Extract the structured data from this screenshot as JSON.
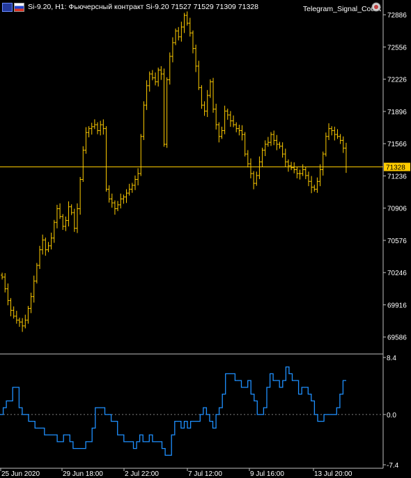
{
  "header": {
    "chart_title": "Si-9.20, H1:  Фьючерсный контракт Si-9.20  71527 71529 71309 71328",
    "ea_name": "Telegram_Signal_Count"
  },
  "colors": {
    "background": "#000000",
    "bars": "#ffcc00",
    "price_line": "#ffcc00",
    "indicator": "#1e90ff",
    "axis": "#c0c0c0",
    "zero_line": "#808080"
  },
  "chart_data": [
    {
      "type": "ohlc",
      "title": "Si-9.20, H1",
      "ylim": [
        69420,
        72980
      ],
      "y_ticks": [
        "72886",
        "72556",
        "72226",
        "71896",
        "71566",
        "71236",
        "70906",
        "70576",
        "70246",
        "69916",
        "69586"
      ],
      "current_price": "71328",
      "close_series": [
        70200,
        70080,
        69960,
        69860,
        69800,
        69760,
        69740,
        69700,
        69760,
        69880,
        70000,
        70160,
        70320,
        70480,
        70580,
        70480,
        70520,
        70600,
        70760,
        70900,
        70820,
        70720,
        70780,
        70920,
        70860,
        70700,
        70900,
        71200,
        71500,
        71680,
        71720,
        71740,
        71760,
        71700,
        71760,
        71720,
        71100,
        71000,
        70960,
        70900,
        70940,
        71000,
        71020,
        71060,
        71100,
        71140,
        71200,
        71260,
        71640,
        71960,
        72160,
        72280,
        72240,
        72200,
        72320,
        72280,
        71560,
        72220,
        72460,
        72600,
        72720,
        72660,
        72760,
        72880,
        72800,
        72700,
        72540,
        72360,
        72140,
        71960,
        71900,
        72060,
        72200,
        71920,
        71760,
        71640,
        71700,
        71900,
        71860,
        71800,
        71760,
        71720,
        71700,
        71660,
        71460,
        71360,
        71260,
        71160,
        71240,
        71380,
        71500,
        71560,
        71580,
        71660,
        71600,
        71560,
        71540,
        71460,
        71380,
        71340,
        71320,
        71300,
        71260,
        71260,
        71300,
        71240,
        71180,
        71120,
        71100,
        71180,
        71300,
        71460,
        71640,
        71720,
        71700,
        71660,
        71640,
        71600,
        71520,
        71328
      ],
      "x_labels": [
        "25 Jun 2020",
        "29 Jun 18:00",
        "2 Jul 22:00",
        "7 Jul 12:00",
        "9 Jul 16:00",
        "13 Jul 20:00"
      ]
    },
    {
      "type": "line",
      "name": "indicator",
      "ylim": [
        -7.4,
        8.4
      ],
      "y_ticks": [
        "8.4",
        "0.0",
        "-7.4"
      ],
      "values": [
        0,
        1,
        2,
        2,
        4,
        4,
        1,
        0,
        0,
        -1,
        -1,
        -2,
        -2,
        -2,
        -3,
        -3,
        -3,
        -3,
        -4,
        -4,
        -3,
        -3,
        -4,
        -5,
        -5,
        -5,
        -5,
        -4,
        -4,
        -2,
        1,
        1,
        1,
        0,
        0,
        -1,
        -1,
        -3,
        -3,
        -4,
        -4,
        -4,
        -5,
        -4,
        -3,
        -4,
        -4,
        -3,
        -4,
        -4,
        -4,
        -5,
        -6,
        -6,
        -3,
        -1,
        -1,
        -2,
        -1,
        -2,
        -1,
        -1,
        -1,
        0,
        1,
        0,
        -1,
        -2,
        0,
        1,
        3,
        6,
        6,
        6,
        5,
        5,
        4,
        4,
        5,
        3,
        2,
        0,
        0,
        1,
        4,
        6,
        5,
        5,
        4,
        5,
        7,
        6,
        5,
        5,
        3,
        4,
        4,
        3,
        2,
        0,
        -1,
        -1,
        0,
        0,
        0,
        0,
        1,
        3,
        5
      ],
      "zero_label": "0.0"
    }
  ]
}
